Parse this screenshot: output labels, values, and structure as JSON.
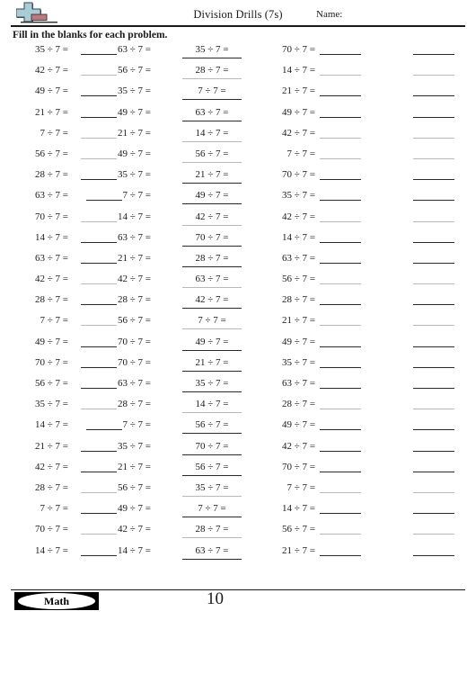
{
  "header": {
    "title": "Division Drills (7s)",
    "name_label": "Name:",
    "logo_icon": "math-plus-logo-icon"
  },
  "instructions": "Fill in the blanks for each problem.",
  "problem": {
    "divisor": "7",
    "operator": "÷",
    "equals": "="
  },
  "columns": {
    "col1_style": "problem-only",
    "col2_style": "blank-then-problem",
    "col3_style": "problem-on-blank",
    "col4_style": "problem-then-blank",
    "col5_style": "blank-only"
  },
  "rows": [
    {
      "c1": "35 ÷ 7 =",
      "c2": "63 ÷ 7 =",
      "c3": "35 ÷ 7 =",
      "c4": "70 ÷ 7 =",
      "faint": false
    },
    {
      "c1": "42 ÷ 7 =",
      "c2": "56 ÷ 7 =",
      "c3": "28 ÷ 7 =",
      "c4": "14 ÷ 7 =",
      "faint": true
    },
    {
      "c1": "49 ÷ 7 =",
      "c2": "35 ÷ 7 =",
      "c3": "7 ÷ 7 =",
      "c4": "21 ÷ 7 =",
      "faint": false
    },
    {
      "c1": "21 ÷ 7 =",
      "c2": "49 ÷ 7 =",
      "c3": "63 ÷ 7 =",
      "c4": "49 ÷ 7 =",
      "faint": false
    },
    {
      "c1": "7 ÷ 7 =",
      "c2": "21 ÷ 7 =",
      "c3": "14 ÷ 7 =",
      "c4": "42 ÷ 7 =",
      "faint": true
    },
    {
      "c1": "56 ÷ 7 =",
      "c2": "49 ÷ 7 =",
      "c3": "56 ÷ 7 =",
      "c4": "7 ÷ 7 =",
      "faint": true
    },
    {
      "c1": "28 ÷ 7 =",
      "c2": "35 ÷ 7 =",
      "c3": "21 ÷ 7 =",
      "c4": "70 ÷ 7 =",
      "faint": false
    },
    {
      "c1": "63 ÷ 7 =",
      "c2": "7 ÷ 7 =",
      "c3": "49 ÷ 7 =",
      "c4": "35 ÷ 7 =",
      "faint": false
    },
    {
      "c1": "70 ÷ 7 =",
      "c2": "14 ÷ 7 =",
      "c3": "42 ÷ 7 =",
      "c4": "42 ÷ 7 =",
      "faint": true
    },
    {
      "c1": "14 ÷ 7 =",
      "c2": "63 ÷ 7 =",
      "c3": "70 ÷ 7 =",
      "c4": "14 ÷ 7 =",
      "faint": false
    },
    {
      "c1": "63 ÷ 7 =",
      "c2": "21 ÷ 7 =",
      "c3": "28 ÷ 7 =",
      "c4": "63 ÷ 7 =",
      "faint": false
    },
    {
      "c1": "42 ÷ 7 =",
      "c2": "42 ÷ 7 =",
      "c3": "63 ÷ 7 =",
      "c4": "56 ÷ 7 =",
      "faint": true
    },
    {
      "c1": "28 ÷ 7 =",
      "c2": "28 ÷ 7 =",
      "c3": "42 ÷ 7 =",
      "c4": "28 ÷ 7 =",
      "faint": false
    },
    {
      "c1": "7 ÷ 7 =",
      "c2": "56 ÷ 7 =",
      "c3": "7 ÷ 7 =",
      "c4": "21 ÷ 7 =",
      "faint": true
    },
    {
      "c1": "49 ÷ 7 =",
      "c2": "70 ÷ 7 =",
      "c3": "49 ÷ 7 =",
      "c4": "49 ÷ 7 =",
      "faint": false
    },
    {
      "c1": "70 ÷ 7 =",
      "c2": "70 ÷ 7 =",
      "c3": "21 ÷ 7 =",
      "c4": "35 ÷ 7 =",
      "faint": false
    },
    {
      "c1": "56 ÷ 7 =",
      "c2": "63 ÷ 7 =",
      "c3": "35 ÷ 7 =",
      "c4": "63 ÷ 7 =",
      "faint": false
    },
    {
      "c1": "35 ÷ 7 =",
      "c2": "28 ÷ 7 =",
      "c3": "14 ÷ 7 =",
      "c4": "28 ÷ 7 =",
      "faint": true
    },
    {
      "c1": "14 ÷ 7 =",
      "c2": "7 ÷ 7 =",
      "c3": "56 ÷ 7 =",
      "c4": "49 ÷ 7 =",
      "faint": false
    },
    {
      "c1": "21 ÷ 7 =",
      "c2": "35 ÷ 7 =",
      "c3": "70 ÷ 7 =",
      "c4": "42 ÷ 7 =",
      "faint": false
    },
    {
      "c1": "42 ÷ 7 =",
      "c2": "21 ÷ 7 =",
      "c3": "56 ÷ 7 =",
      "c4": "70 ÷ 7 =",
      "faint": false
    },
    {
      "c1": "28 ÷ 7 =",
      "c2": "56 ÷ 7 =",
      "c3": "35 ÷ 7 =",
      "c4": "7 ÷ 7 =",
      "faint": true
    },
    {
      "c1": "7 ÷ 7 =",
      "c2": "49 ÷ 7 =",
      "c3": "7 ÷ 7 =",
      "c4": "14 ÷ 7 =",
      "faint": false
    },
    {
      "c1": "70 ÷ 7 =",
      "c2": "42 ÷ 7 =",
      "c3": "28 ÷ 7 =",
      "c4": "56 ÷ 7 =",
      "faint": true
    },
    {
      "c1": "14 ÷ 7 =",
      "c2": "14 ÷ 7 =",
      "c3": "63 ÷ 7 =",
      "c4": "21 ÷ 7 =",
      "faint": false
    }
  ],
  "footer": {
    "brand": "Math",
    "page_number": "10"
  }
}
